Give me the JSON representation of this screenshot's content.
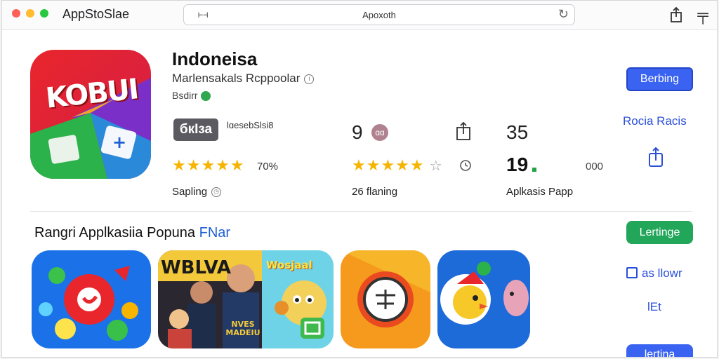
{
  "window": {
    "title": "AppStoSlae"
  },
  "address_bar": {
    "text": "Apoxoth",
    "left_icon_text": "⊢⊣"
  },
  "hero": {
    "icon_text": "KOBUI",
    "name": "Indoneisa",
    "subtitle": "Marlensakals Rcppoolar",
    "developer": "Bsdirr",
    "age_badge": "бкІза",
    "badge_caption": "lɑesebSlsi8",
    "stars_left": "★★★★★",
    "percent": "70%",
    "caption_left": "Sapling",
    "rating_count": "9",
    "rating_badge": "ɑɑ",
    "stars_mid": "★★★★★",
    "empty_star": "☆",
    "caption_mid": "26 flaning",
    "stat_top": "35",
    "stat_bottom": "19",
    "stat_side": "000",
    "caption_right": "Aplkasis Papp",
    "primary_button": "Berbing",
    "link_text": "Rocia Racis"
  },
  "section": {
    "title_main": "Rangri Applkasiia Popuna",
    "title_accent": "FNar",
    "green_button": "Lertinge",
    "checkbox_label": "as llowr",
    "et_text": "lEt",
    "bottom_button": "lertina"
  },
  "tiles": {
    "tile2_text": "WBLVA",
    "tile2_subtext": "NVES MADEIU",
    "tile3_text": "Wosjaal"
  },
  "colors": {
    "accent_blue": "#3a63f2",
    "link_blue": "#2a4fd9",
    "green": "#22a65a",
    "star": "#f6b400"
  }
}
